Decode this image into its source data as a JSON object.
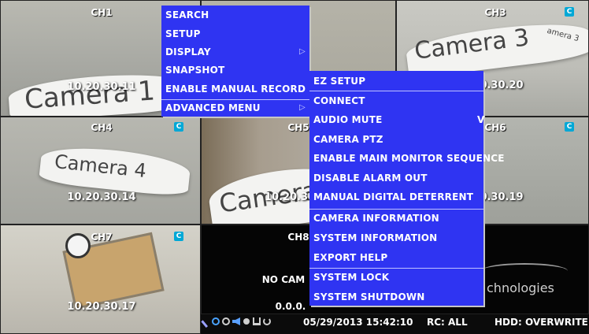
{
  "channels": {
    "ch1": {
      "label": "CH1",
      "ip": "10.20.30.11",
      "sign": "Camera 1"
    },
    "ch3": {
      "label": "CH3",
      "ip": "0.30.20",
      "sign": "Camera 3",
      "sign_small": "amera 3"
    },
    "ch4": {
      "label": "CH4",
      "ip": "10.20.30.14",
      "sign": "Camera 4"
    },
    "ch5": {
      "label": "CH5",
      "ip": "10.20.30",
      "sign": "Camera"
    },
    "ch6": {
      "label": "CH6",
      "ip": "0.30.19"
    },
    "ch7": {
      "label": "CH7",
      "ip": "10.20.30.17"
    },
    "ch8": {
      "label": "CH8",
      "status": "NO CAM",
      "ip": "0.0.0.",
      "watermark": "chnologies"
    },
    "badge": "C"
  },
  "main_menu": {
    "items": [
      "SEARCH",
      "SETUP",
      "DISPLAY",
      "SNAPSHOT",
      "ENABLE MANUAL RECORD",
      "ADVANCED MENU"
    ],
    "submenu_arrow": "▷"
  },
  "advanced_menu": {
    "items": [
      "EZ SETUP",
      "CONNECT",
      "AUDIO MUTE",
      "CAMERA PTZ",
      "ENABLE MAIN MONITOR SEQUENCE",
      "DISABLE ALARM OUT",
      "MANUAL DIGITAL DETERRENT",
      "CAMERA INFORMATION",
      "SYSTEM INFORMATION",
      "EXPORT HELP",
      "SYSTEM LOCK",
      "SYSTEM SHUTDOWN"
    ],
    "check_mark": "V"
  },
  "status_bar": {
    "datetime": "05/29/2013 15:42:10",
    "rc": "RC: ALL",
    "hdd": "HDD: OVERWRITE",
    "icons": [
      "wrench-icon",
      "network-icon",
      "clock-icon",
      "speaker-icon",
      "sun-icon",
      "lan-icon",
      "refresh-icon"
    ]
  },
  "colors": {
    "menu_bg": "#2f34f2",
    "badge": "#00a8d6"
  }
}
